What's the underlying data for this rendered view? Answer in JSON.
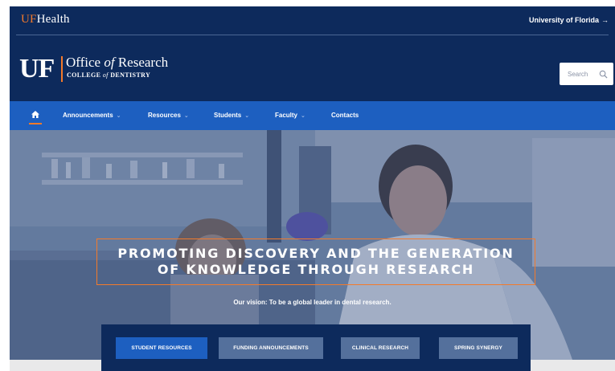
{
  "topbar": {
    "brand_uf": "UF",
    "brand_health": "Health",
    "university_link": "University of Florida",
    "university_arrow": "→"
  },
  "brand": {
    "logo": "UF",
    "office_prefix": "Office",
    "office_of": "of",
    "office_suffix": "Research",
    "college_prefix": "COLLEGE",
    "college_of": "of",
    "college_suffix": "DENTISTRY",
    "search_placeholder": "Search"
  },
  "nav": {
    "items": [
      {
        "label": "Announcements",
        "chevron": "⌄"
      },
      {
        "label": "Resources",
        "chevron": "⌄"
      },
      {
        "label": "Students",
        "chevron": "⌄"
      },
      {
        "label": "Faculty",
        "chevron": "⌄"
      },
      {
        "label": "Contacts"
      }
    ]
  },
  "hero": {
    "headline_line1": "PROMOTING DISCOVERY AND THE GENERATION",
    "headline_line2": "OF KNOWLEDGE THROUGH RESEARCH",
    "vision": "Our vision: To be a global leader in dental research."
  },
  "quick_links": [
    {
      "label": "STUDENT RESOURCES"
    },
    {
      "label": "FUNDING ANNOUNCEMENTS"
    },
    {
      "label": "CLINICAL RESEARCH"
    },
    {
      "label": "SPRING SYNERGY"
    }
  ],
  "colors": {
    "navy": "#0d2a5c",
    "blue": "#1d5fc0",
    "orange": "#f47a2a",
    "button_grey_blue": "#54709c"
  }
}
